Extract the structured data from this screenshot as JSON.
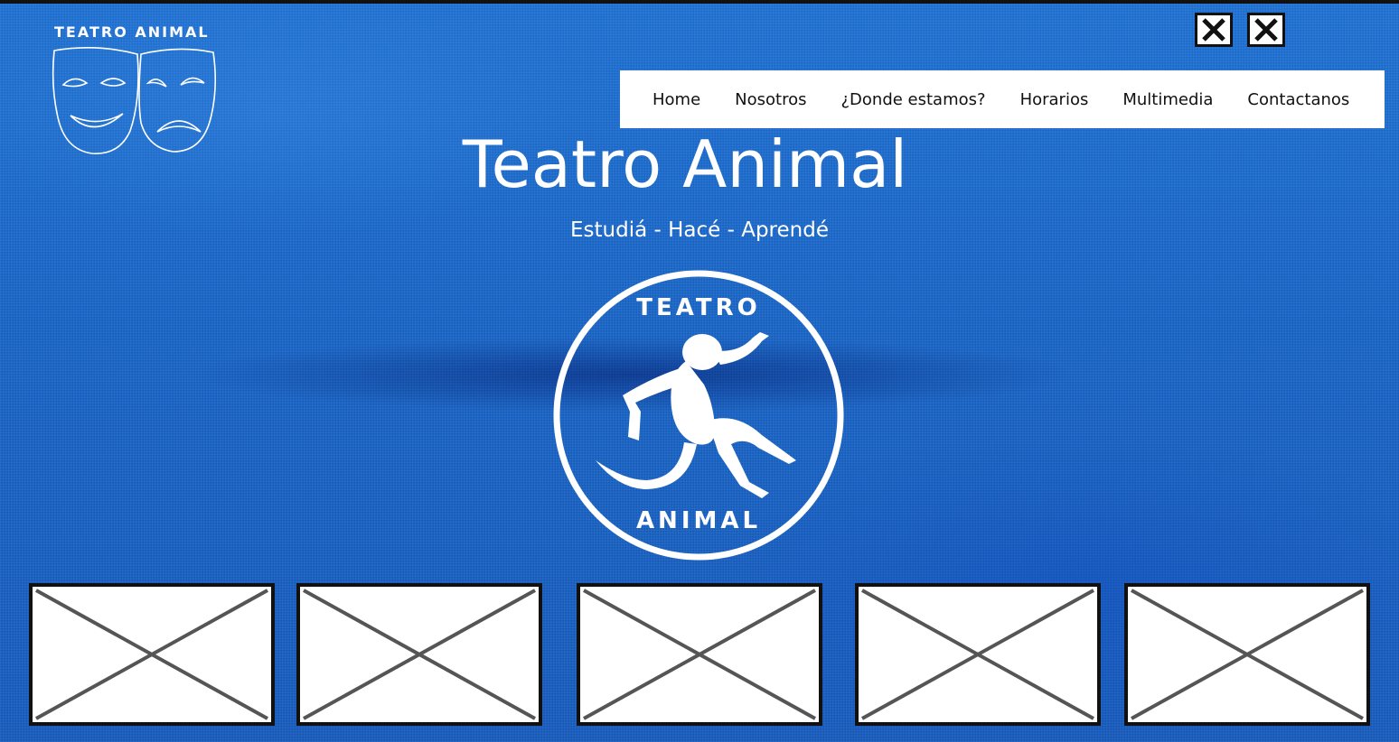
{
  "header": {
    "logo_text": "TEATRO ANIMAL"
  },
  "nav": {
    "items": [
      {
        "label": "Home"
      },
      {
        "label": "Nosotros"
      },
      {
        "label": "¿Donde estamos?"
      },
      {
        "label": "Horarios"
      },
      {
        "label": "Multimedia"
      },
      {
        "label": "Contactanos"
      }
    ]
  },
  "hero": {
    "title": "Teatro Animal",
    "subtitle": "Estudiá - Hacé - Aprendé"
  },
  "emblem": {
    "top_text": "TEATRO",
    "bottom_text": "ANIMAL"
  },
  "icons": {
    "window_buttons": [
      "close-icon",
      "close-icon"
    ],
    "logo": "theater-masks-icon",
    "placeholders": [
      "image-placeholder-icon",
      "image-placeholder-icon",
      "image-placeholder-icon",
      "image-placeholder-icon",
      "image-placeholder-icon"
    ]
  },
  "colors": {
    "background": "#1565c8",
    "nav_background": "#ffffff",
    "text_light": "#ffffff",
    "text_dark": "#111111"
  }
}
